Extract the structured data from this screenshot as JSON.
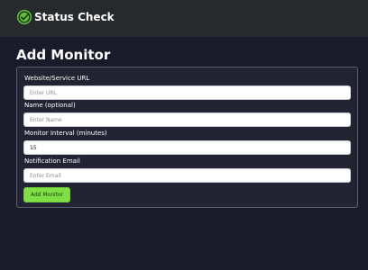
{
  "app": {
    "title": "Status Check",
    "logo_icon": "check-circle-icon",
    "accent_color": "#7ee045"
  },
  "page": {
    "title": "Add Monitor"
  },
  "form": {
    "url": {
      "label": "Website/Service URL",
      "placeholder": "Enter URL",
      "value": ""
    },
    "name": {
      "label": "Name (optional)",
      "placeholder": "Enter Name",
      "value": ""
    },
    "interval": {
      "label": "Monitor Interval (minutes)",
      "placeholder": "",
      "value": "15"
    },
    "email": {
      "label": "Notification Email",
      "placeholder": "Enter Email",
      "value": ""
    },
    "submit_label": "Add Monitor"
  }
}
